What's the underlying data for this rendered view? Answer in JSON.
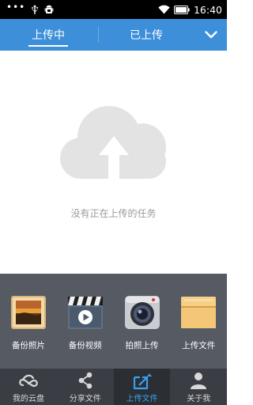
{
  "status_bar": {
    "time": "16:40"
  },
  "tabs": {
    "uploading": "上传中",
    "uploaded": "已上传"
  },
  "empty_state": {
    "message": "没有正在上传的任务"
  },
  "actions": [
    {
      "label": "备份照片",
      "icon": "photo-frame-icon"
    },
    {
      "label": "备份视频",
      "icon": "video-clapper-icon"
    },
    {
      "label": "拍照上传",
      "icon": "camera-icon"
    },
    {
      "label": "上传文件",
      "icon": "folder-icon"
    }
  ],
  "bottom_nav": [
    {
      "label": "我的云盘",
      "icon": "cloud-link-icon",
      "active": false
    },
    {
      "label": "分享文件",
      "icon": "share-icon",
      "active": false
    },
    {
      "label": "上传文件",
      "icon": "upload-icon",
      "active": true
    },
    {
      "label": "关于我",
      "icon": "person-icon",
      "active": false
    }
  ],
  "colors": {
    "accent": "#3d8fd9",
    "active_nav": "#38a0ee",
    "panel": "#555a63",
    "nav_bg": "#3a3d43"
  }
}
